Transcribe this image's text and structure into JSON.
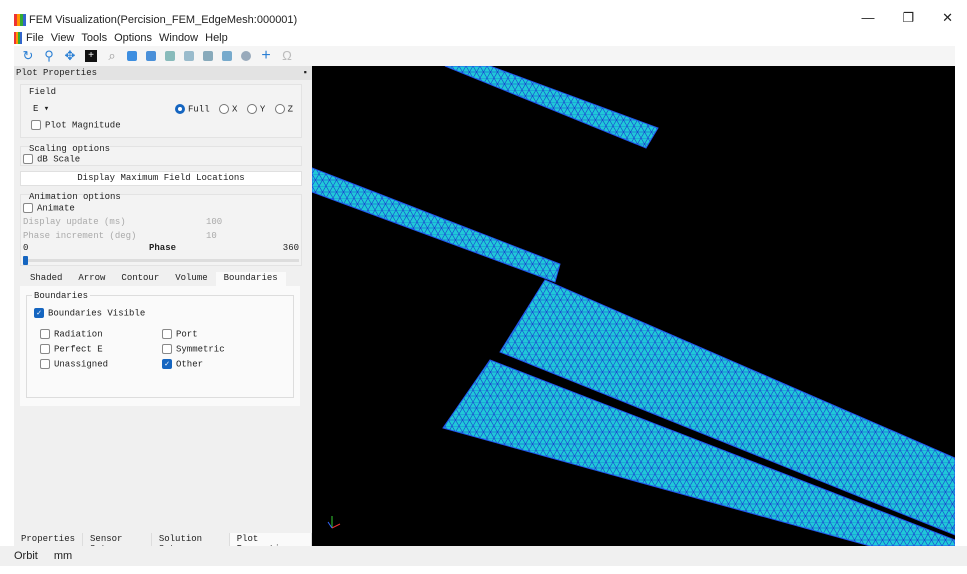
{
  "window": {
    "title": "FEM Visualization(Percision_FEM_EdgeMesh:000001)",
    "minimize": "—",
    "restore": "❐",
    "close": "✕"
  },
  "menu": [
    "File",
    "View",
    "Tools",
    "Options",
    "Window",
    "Help"
  ],
  "toolbar": [
    "orbit-icon",
    "zoom-icon",
    "pan-icon",
    "fit-icon",
    "zoom-window-icon",
    "view-front-icon",
    "view-back-icon",
    "view-top-icon",
    "view-bottom-icon",
    "view-left-icon",
    "view-right-icon",
    "view-iso-icon",
    "axis-icon",
    "rule-icon"
  ],
  "panel": {
    "title": "Plot Properties",
    "float": "▪",
    "field": {
      "label": "Field",
      "value": "E",
      "components": [
        "Full",
        "X",
        "Y",
        "Z"
      ],
      "selected": "Full",
      "plot_magnitude": "Plot Magnitude"
    },
    "scaling": {
      "label": "Scaling options",
      "db_scale": "dB Scale"
    },
    "display_max": "Display Maximum Field Locations",
    "animation": {
      "label": "Animation options",
      "animate": "Animate",
      "display_update_label": "Display update (ms)",
      "display_update": "100",
      "phase_inc_label": "Phase increment (deg)",
      "phase_inc": "10",
      "phase_label": "Phase",
      "phase_min": "0",
      "phase_max": "360",
      "phase_value": 0
    },
    "tabs": [
      "Shaded",
      "Arrow",
      "Contour",
      "Volume",
      "Boundaries"
    ],
    "active_tab": "Boundaries",
    "boundaries": {
      "label": "Boundaries",
      "visible": "Boundaries Visible",
      "radiation": "Radiation",
      "port": "Port",
      "perfect_e": "Perfect E",
      "symmetric": "Symmetric",
      "unassigned": "Unassigned",
      "other": "Other"
    }
  },
  "bottom_tabs": [
    "Properties",
    "Sensor Setup",
    "Solution Setup",
    "Plot Properties"
  ],
  "status": {
    "mode": "Orbit",
    "units": "mm"
  },
  "colors": {
    "mesh_fill": "#20c8d8",
    "mesh_line": "#1a3fd0",
    "accent": "#1565c0"
  }
}
